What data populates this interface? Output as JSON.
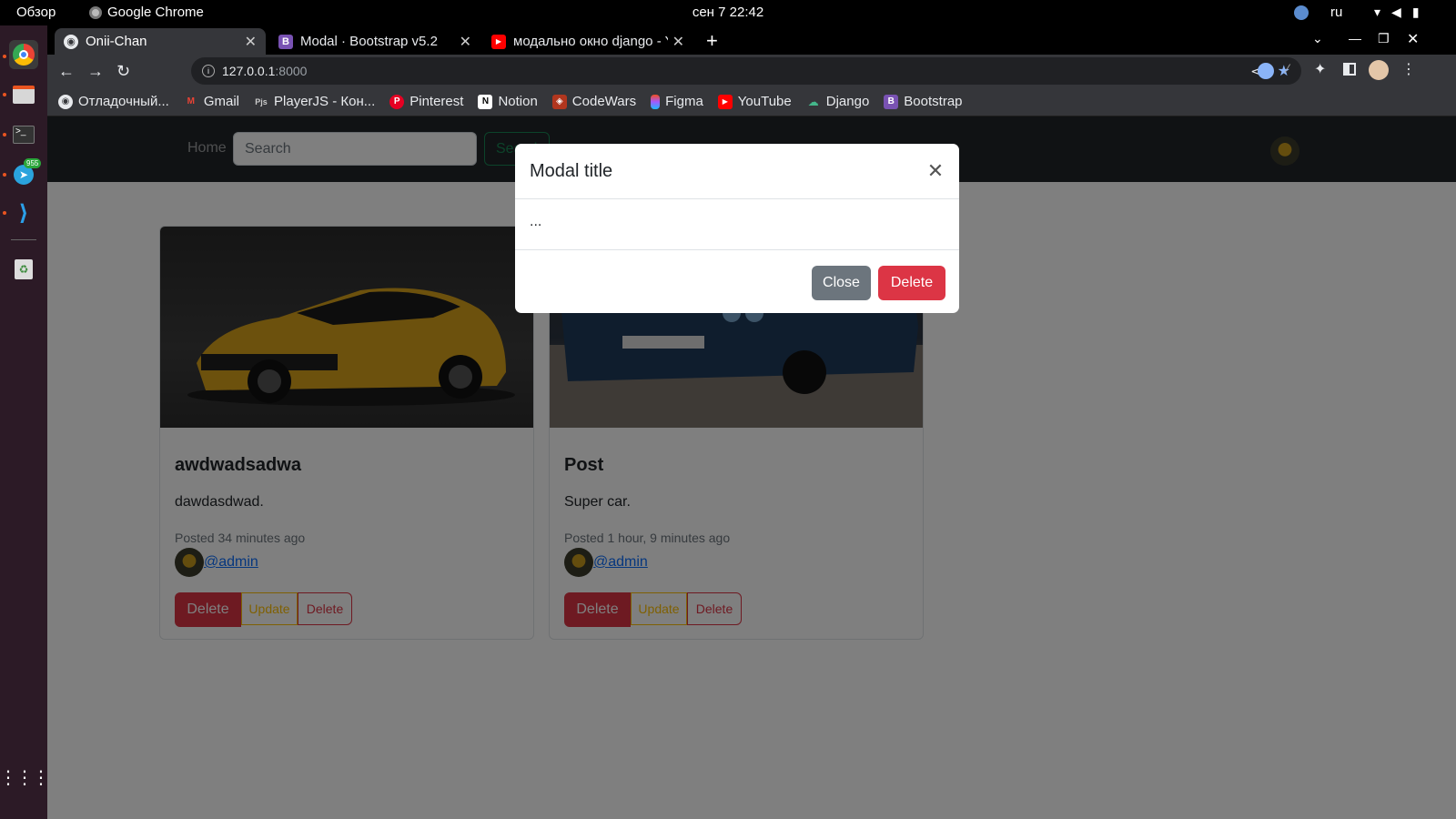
{
  "system": {
    "overview": "Обзор",
    "app_name": "Google Chrome",
    "clock": "сен 7  22:42",
    "lang": "ru",
    "telegram_badge": "955"
  },
  "tabs": [
    {
      "title": "Onii-Chan",
      "active": true
    },
    {
      "title": "Modal · Bootstrap v5.2",
      "active": false
    },
    {
      "title": "модально окно django - Y",
      "active": false
    }
  ],
  "toolbar": {
    "url_host": "127.0.0.1",
    "url_port": ":8000"
  },
  "bookmarks": [
    {
      "label": "Отладочный...",
      "icon": "globe-icon",
      "color": "#555"
    },
    {
      "label": "Gmail",
      "icon": "gmail-icon",
      "color": "#ea4335"
    },
    {
      "label": "PlayerJS - Кон...",
      "icon": "playerjs-icon",
      "color": "#444"
    },
    {
      "label": "Pinterest",
      "icon": "pinterest-icon",
      "color": "#e60023"
    },
    {
      "label": "Notion",
      "icon": "notion-icon",
      "color": "#fff"
    },
    {
      "label": "CodeWars",
      "icon": "codewars-icon",
      "color": "#b1361e"
    },
    {
      "label": "Figma",
      "icon": "figma-icon",
      "color": "#f24e1e"
    },
    {
      "label": "YouTube",
      "icon": "youtube-icon",
      "color": "#ff0000"
    },
    {
      "label": "Django",
      "icon": "django-icon",
      "color": "#44b78b"
    },
    {
      "label": "Bootstrap",
      "icon": "bootstrap-icon",
      "color": "#7952b3"
    }
  ],
  "navbar": {
    "home": "Home",
    "search_placeholder": "Search",
    "search_button": "Search"
  },
  "posts": [
    {
      "title": "awdwadsadwa",
      "text": "dawdasdwad.",
      "meta": "Posted 34 minutes ago",
      "author": "@admin",
      "btn_delete_main": "Delete",
      "btn_update": "Update",
      "btn_delete": "Delete"
    },
    {
      "title": "Post",
      "text": "Super car.",
      "meta": "Posted 1 hour, 9 minutes ago",
      "author": "@admin",
      "btn_delete_main": "Delete",
      "btn_update": "Update",
      "btn_delete": "Delete"
    }
  ],
  "modal": {
    "title": "Modal title",
    "body": "...",
    "close_label": "Close",
    "delete_label": "Delete"
  }
}
